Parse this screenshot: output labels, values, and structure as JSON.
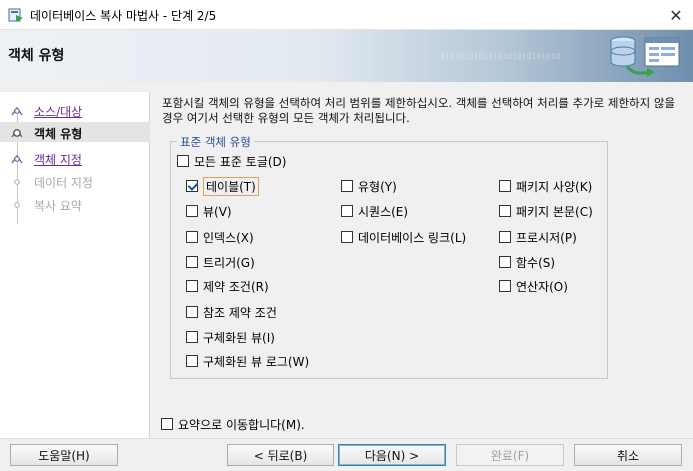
{
  "window": {
    "title": "데이터베이스 복사 마법사 - 단계 2/5",
    "close_glyph": "✕"
  },
  "banner": {
    "heading": "객체 유형",
    "binary_text": "0101010101010101010101010"
  },
  "steps": [
    {
      "label": "소스/대상",
      "state": "done"
    },
    {
      "label": "객체 유형",
      "state": "current"
    },
    {
      "label": "객체 지정",
      "state": "done"
    },
    {
      "label": "데이터 지정",
      "state": "pending"
    },
    {
      "label": "복사 요약",
      "state": "pending"
    }
  ],
  "description": "포함시킬 객체의 유형을 선택하여 처리 범위를 제한하십시오. 객체를 선택하여 처리를 추가로 제한하지 않을 경우 여기서 선택한 유형의 모든 객체가 처리됩니다.",
  "group": {
    "legend": "표준 객체 유형",
    "all_toggle": {
      "label": "모든 표준 토글(D)",
      "checked": false
    },
    "col1": [
      {
        "label": "테이블(T)",
        "checked": true,
        "focused": true
      },
      {
        "label": "뷰(V)",
        "checked": false
      },
      {
        "label": "인덱스(X)",
        "checked": false
      },
      {
        "label": "트리거(G)",
        "checked": false
      },
      {
        "label": "제약 조건(R)",
        "checked": false
      },
      {
        "label": "참조 제약 조건",
        "checked": false
      },
      {
        "label": "구체화된 뷰(I)",
        "checked": false
      },
      {
        "label": "구체화된 뷰 로그(W)",
        "checked": false
      }
    ],
    "col2": [
      {
        "label": "유형(Y)",
        "checked": false
      },
      {
        "label": "시퀀스(E)",
        "checked": false
      },
      {
        "label": "데이터베이스 링크(L)",
        "checked": false
      }
    ],
    "col3": [
      {
        "label": "패키지 사양(K)",
        "checked": false
      },
      {
        "label": "패키지 본문(C)",
        "checked": false
      },
      {
        "label": "프로시저(P)",
        "checked": false
      },
      {
        "label": "함수(S)",
        "checked": false
      },
      {
        "label": "연산자(O)",
        "checked": false
      }
    ]
  },
  "summary_toggle": {
    "label": "요약으로 이동합니다(M).",
    "checked": false
  },
  "buttons": {
    "help": "도움말(H)",
    "back": "< 뒤로(B)",
    "next": "다음(N) >",
    "finish": "완료(F)",
    "cancel": "취소"
  }
}
